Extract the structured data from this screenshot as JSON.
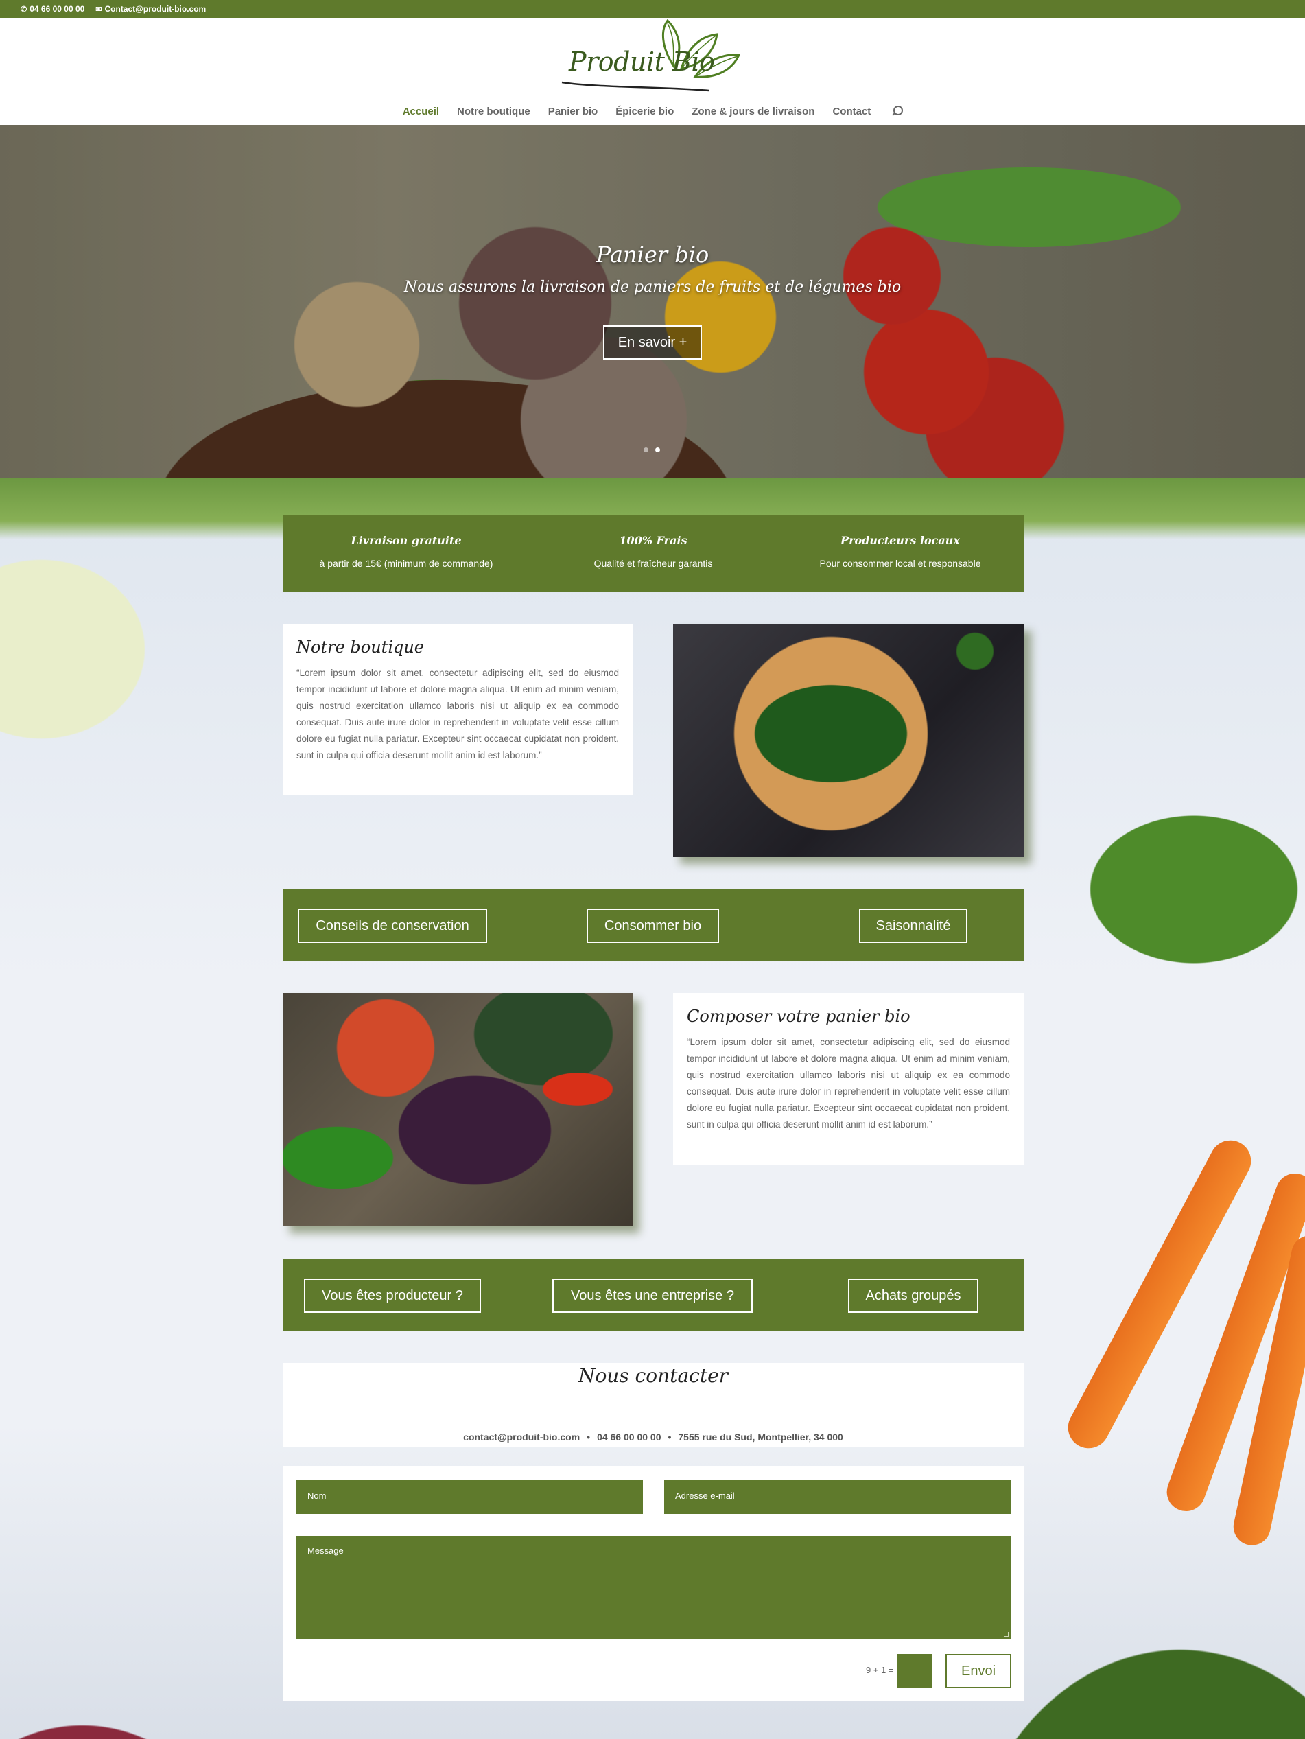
{
  "topbar": {
    "phone": "04 66 00 00 00",
    "email": "Contact@produit-bio.com"
  },
  "header": {
    "logo_text": "Produit Bio",
    "nav": [
      {
        "label": "Accueil",
        "active": true
      },
      {
        "label": "Notre boutique"
      },
      {
        "label": "Panier bio"
      },
      {
        "label": "Épicerie bio"
      },
      {
        "label": "Zone & jours de livraison"
      },
      {
        "label": "Contact"
      }
    ]
  },
  "hero": {
    "title": "Panier bio",
    "subtitle": "Nous assurons la livraison de paniers de fruits et de légumes bio",
    "button": "En savoir +",
    "slides": 2,
    "active_slide": 2
  },
  "features": [
    {
      "title": "Livraison gratuite",
      "desc": "à partir de 15€ (minimum de commande)"
    },
    {
      "title": "100% Frais",
      "desc": "Qualité et fraîcheur garantis"
    },
    {
      "title": "Producteurs locaux",
      "desc": "Pour consommer local et responsable"
    }
  ],
  "boutique": {
    "title": "Notre boutique",
    "text": "“Lorem ipsum dolor sit amet, consectetur adipiscing elit, sed do eiusmod tempor incididunt ut labore et dolore magna aliqua. Ut enim ad minim veniam, quis nostrud exercitation ullamco laboris nisi ut aliquip ex ea commodo consequat. Duis aute irure dolor in reprehenderit in voluptate velit esse cillum dolore eu fugiat nulla pariatur. Excepteur sint occaecat cupidatat non proident, sunt in culpa qui officia deserunt mollit anim id est laborum.”"
  },
  "band1": [
    "Conseils de conservation",
    "Consommer bio",
    "Saisonnalité"
  ],
  "composer": {
    "title": "Composer votre panier bio",
    "text": "“Lorem ipsum dolor sit amet, consectetur adipiscing elit, sed do eiusmod tempor incididunt ut labore et dolore magna aliqua. Ut enim ad minim veniam, quis nostrud exercitation ullamco laboris nisi ut aliquip ex ea commodo consequat. Duis aute irure dolor in reprehenderit in voluptate velit esse cillum dolore eu fugiat nulla pariatur. Excepteur sint occaecat cupidatat non proident, sunt in culpa qui officia deserunt mollit anim id est laborum.”"
  },
  "band2": [
    "Vous êtes producteur ?",
    "Vous êtes une entreprise ?",
    "Achats groupés"
  ],
  "contact": {
    "title": "Nous contacter",
    "email": "contact@produit-bio.com",
    "phone": "04 66 00 00 00",
    "address": "7555 rue du Sud, Montpellier, 34 000",
    "separator": "•",
    "form": {
      "name_placeholder": "Nom",
      "email_placeholder": "Adresse e-mail",
      "message_placeholder": "Message",
      "captcha": "9 + 1 =",
      "submit": "Envoi"
    }
  },
  "colors": {
    "brand_green": "#5f7a2c"
  }
}
